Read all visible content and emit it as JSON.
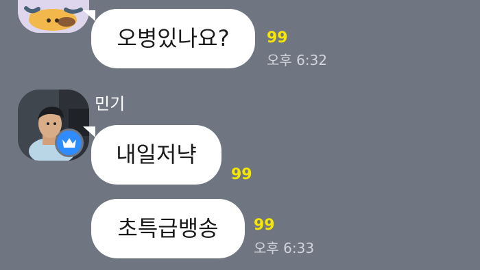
{
  "messages": [
    {
      "text": "오병있나요?",
      "unread": "99",
      "time": "오후 6:32"
    },
    {
      "sender": "민기",
      "text": "내일저냑",
      "unread": "99"
    },
    {
      "text": "초특급뱅송",
      "unread": "99",
      "time": "오후 6:33"
    }
  ],
  "colors": {
    "background": "#6f7682",
    "bubble": "#ffffff",
    "unread": "#f7e600",
    "badge": "#2f8cff"
  },
  "icons": {
    "avatar_1": "character-profile-photo",
    "avatar_2": "person-profile-photo",
    "badge": "crown-icon"
  }
}
